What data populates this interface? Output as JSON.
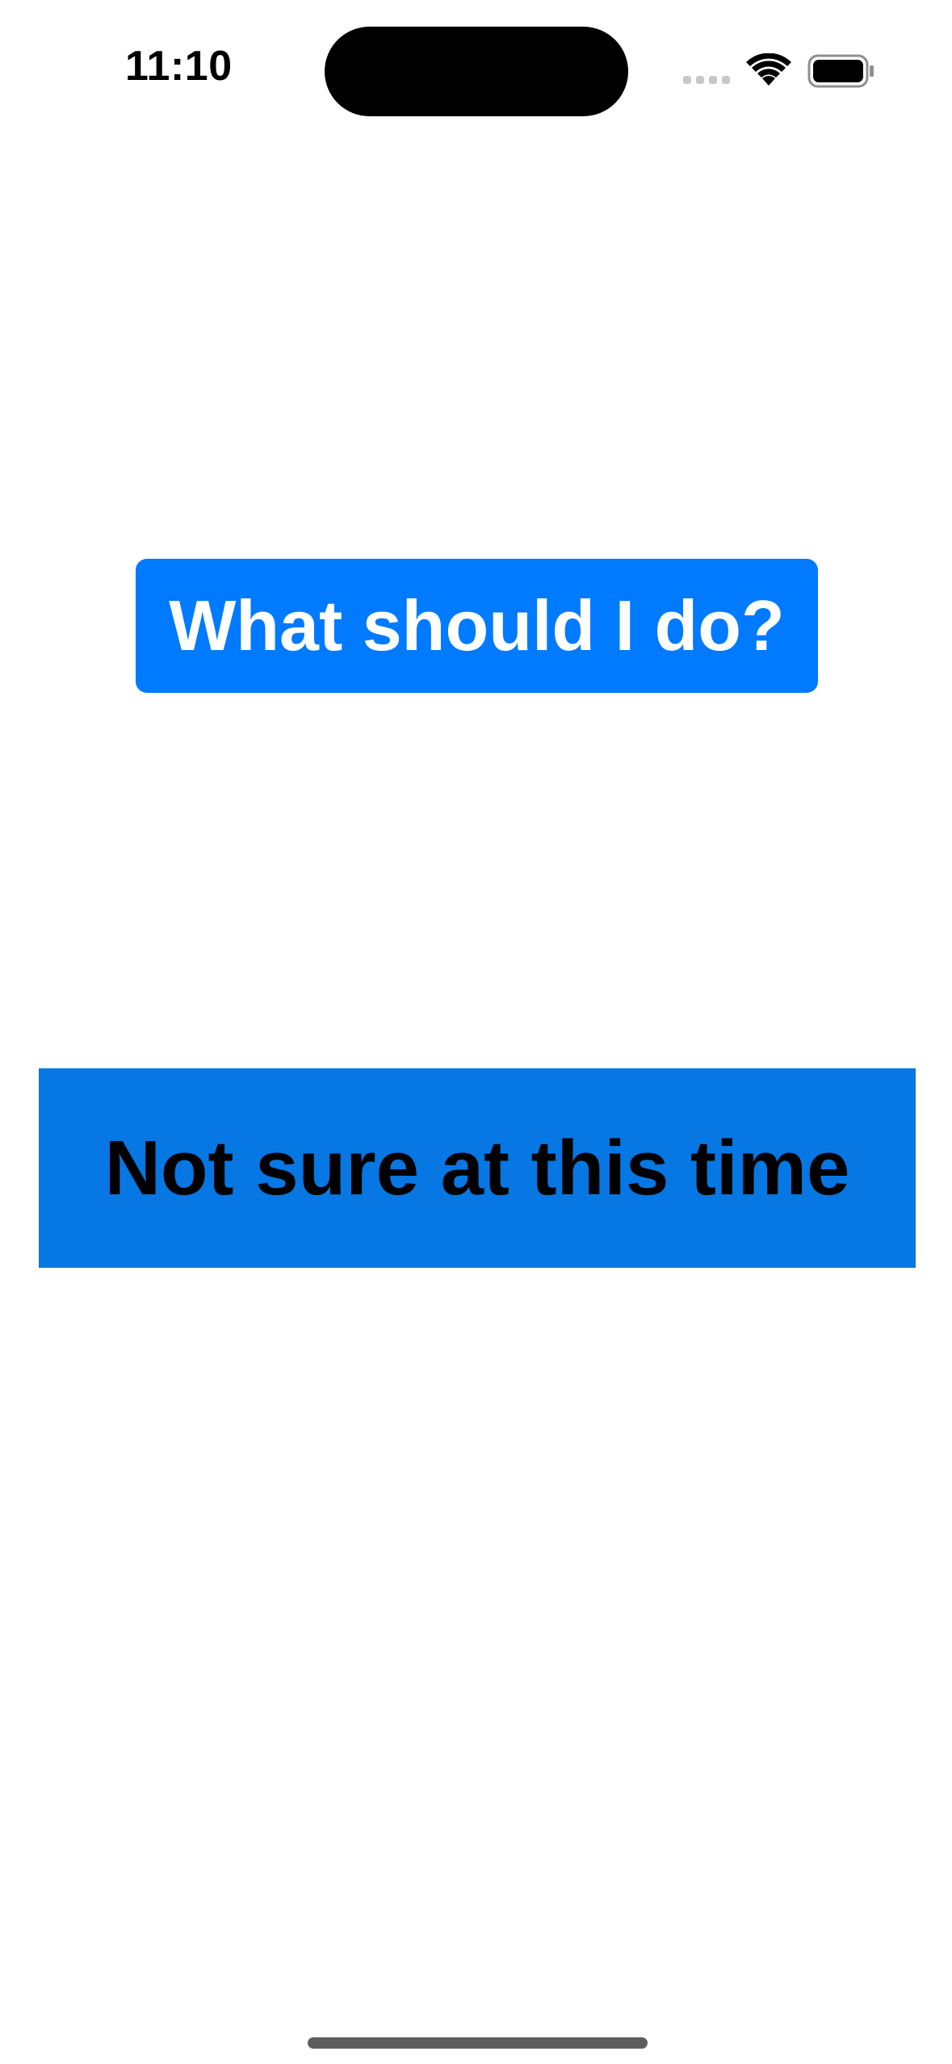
{
  "status_bar": {
    "time": "11:10",
    "icons": [
      "cellular-signal-icon",
      "wifi-icon",
      "battery-icon"
    ]
  },
  "main": {
    "question_button_label": "What should I do?",
    "answer_text": "Not sure at this time"
  },
  "colors": {
    "question_button_bg": "#007aff",
    "answer_box_bg": "#0677e3",
    "answer_text": "#000000",
    "question_text": "#ffffff"
  }
}
